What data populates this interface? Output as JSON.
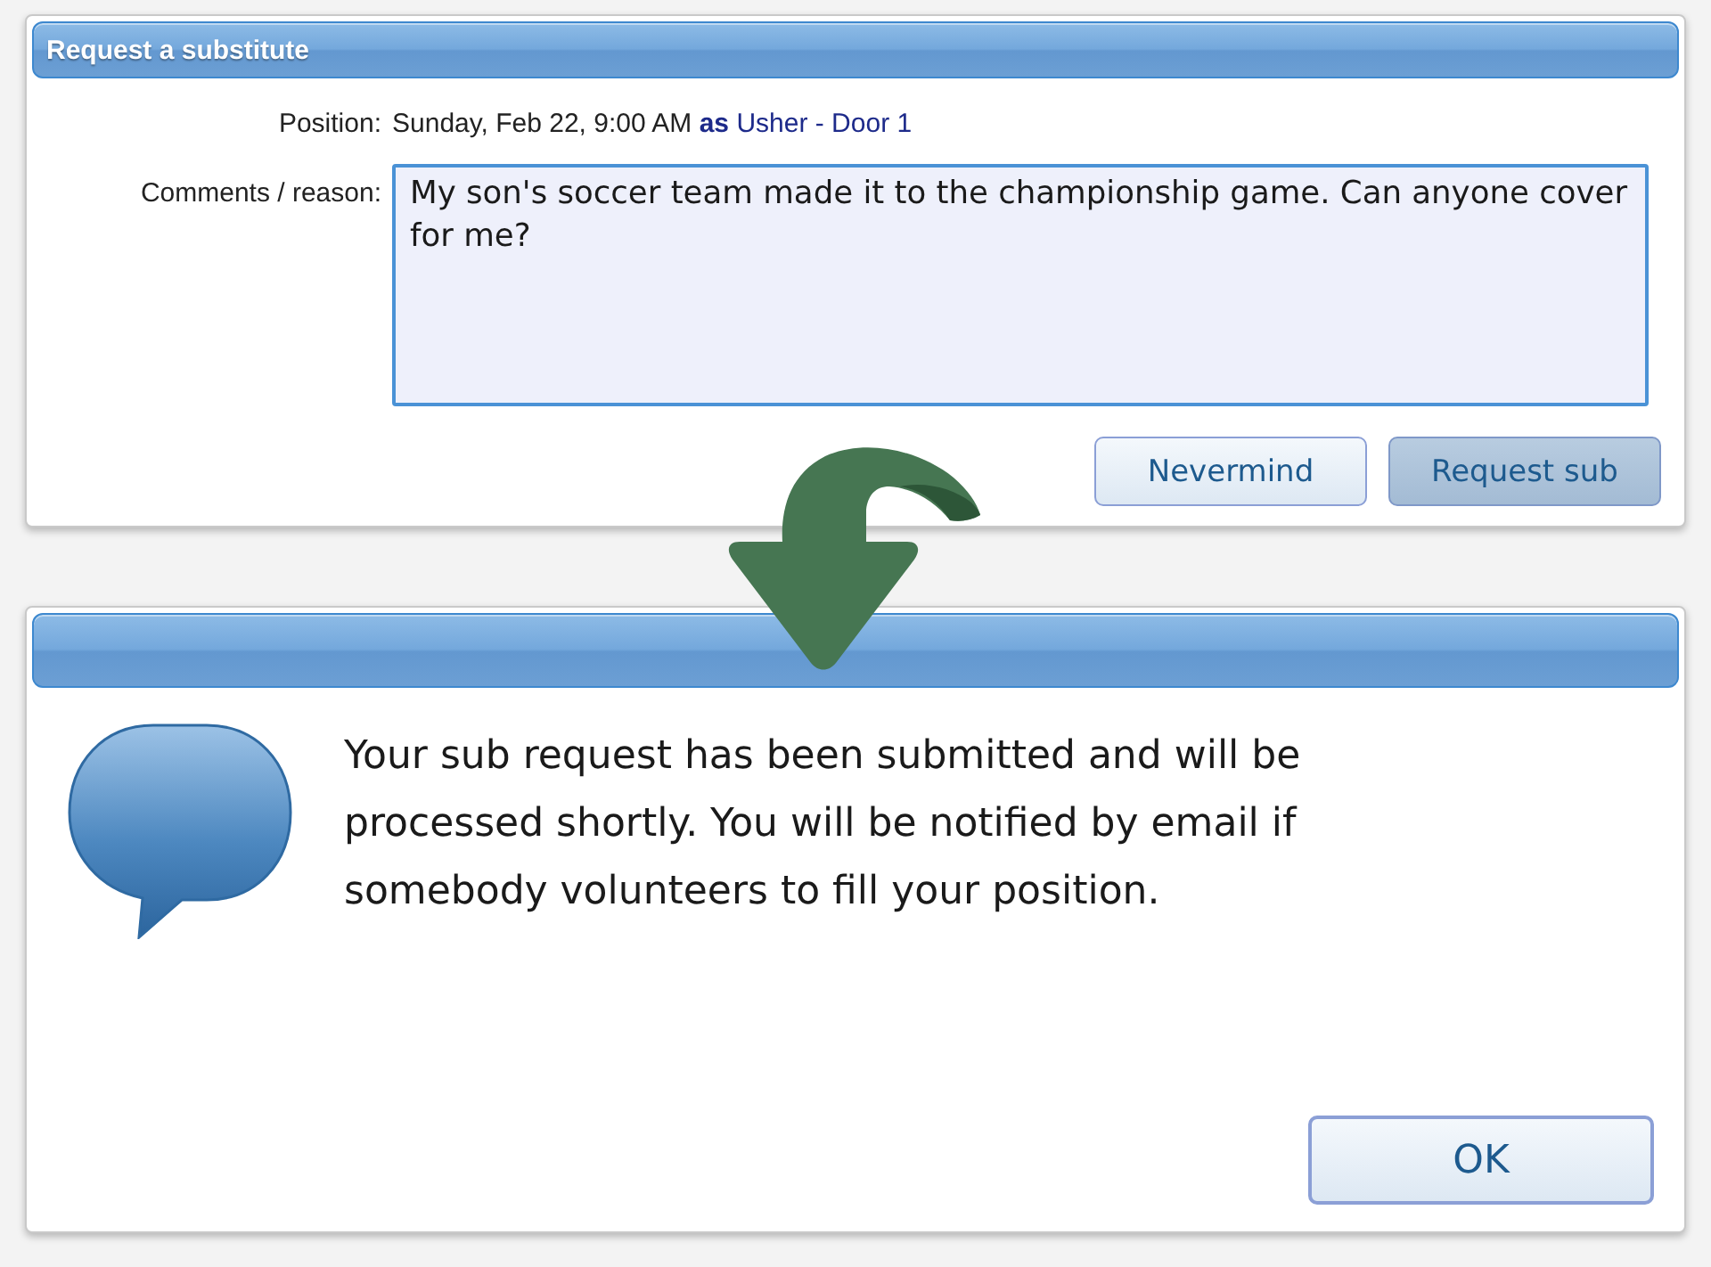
{
  "request_dialog": {
    "title": "Request a substitute",
    "position": {
      "label": "Position:",
      "parts": [
        {
          "kind": "plain",
          "text": "Sunday, Feb 22, 9:00 AM"
        },
        {
          "kind": "keyword",
          "text": "as"
        },
        {
          "kind": "link",
          "text": "Usher - Door 1"
        }
      ]
    },
    "comments": {
      "label": "Comments / reason:",
      "value": "My son's soccer team made it to the championship game. Can anyone cover for me?"
    },
    "buttons": [
      {
        "label": "Nevermind",
        "primary": false
      },
      {
        "label": "Request sub",
        "primary": true
      }
    ]
  },
  "confirmation_dialog": {
    "message": "Your sub request has been submitted and will be processed shortly. You will be notified by email if somebody volunteers to fill your position.",
    "buttons": [
      {
        "label": "OK",
        "primary": false
      }
    ]
  }
}
